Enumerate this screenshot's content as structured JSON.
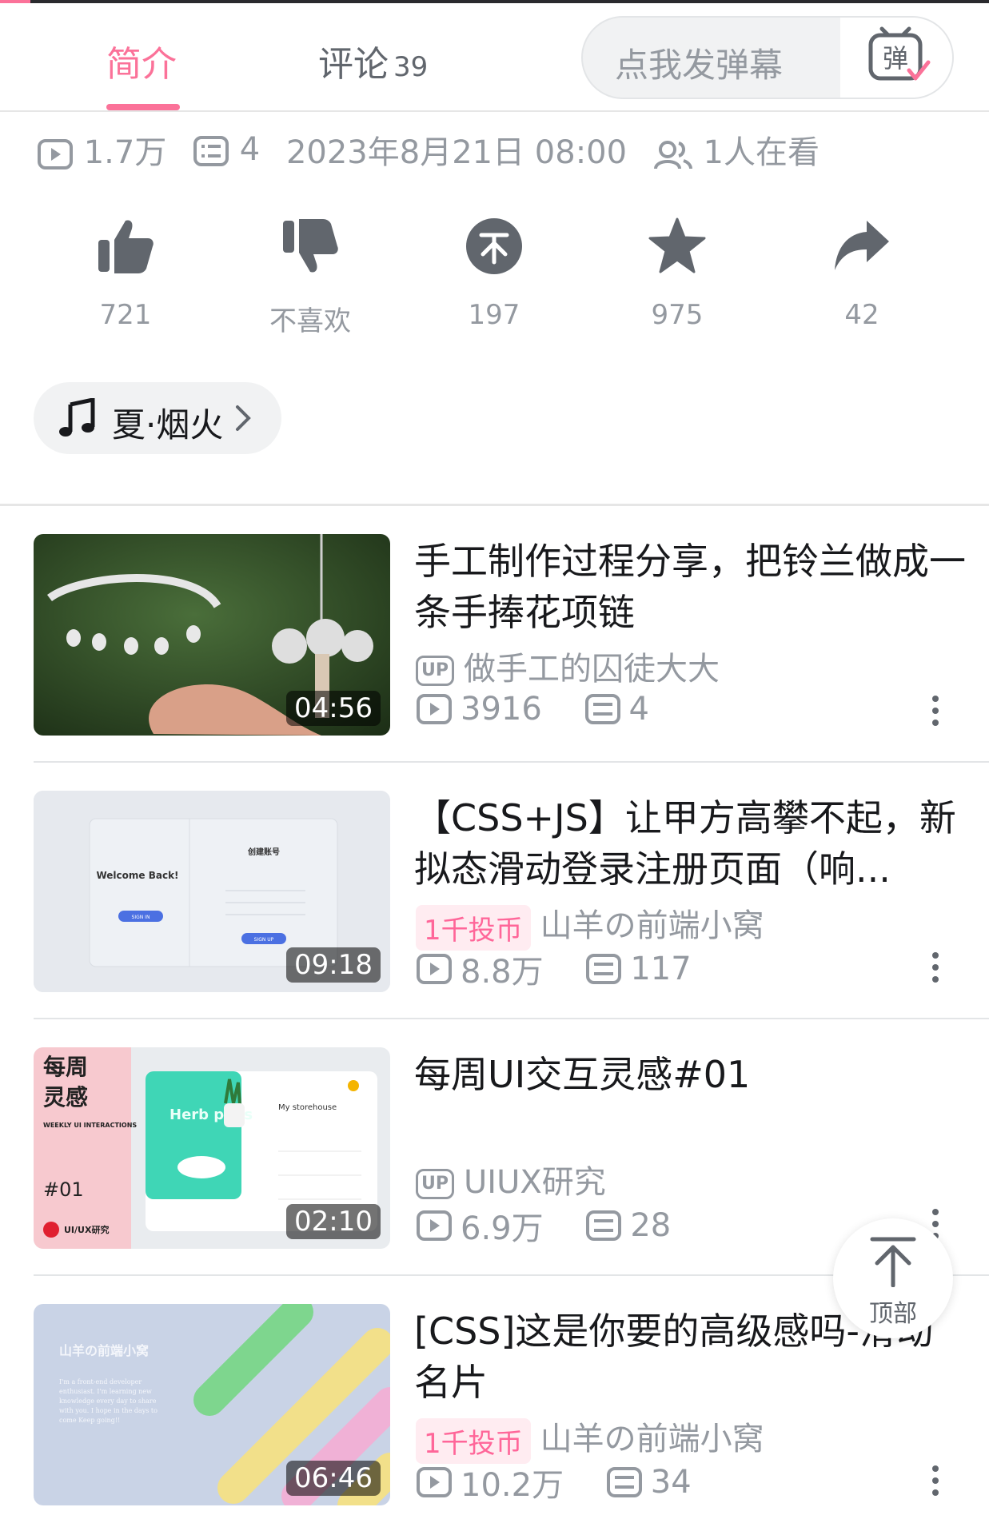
{
  "tabs": [
    {
      "label": "简介",
      "active": true
    },
    {
      "label": "评论",
      "count": "39",
      "active": false
    }
  ],
  "danmaku": {
    "placeholder": "点我发弹幕",
    "button_icon": "danmaku-toggle-icon",
    "button_glyph": "弹"
  },
  "stats": {
    "views": "1.7万",
    "danmaku_count": "4",
    "publish_time": "2023年8月21日 08:00",
    "watching": "1人在看"
  },
  "actions": [
    {
      "icon": "thumb-up-icon",
      "label": "721"
    },
    {
      "icon": "thumb-down-icon",
      "label": "不喜欢"
    },
    {
      "icon": "coin-icon",
      "label": "197"
    },
    {
      "icon": "star-icon",
      "label": "975"
    },
    {
      "icon": "share-icon",
      "label": "42"
    }
  ],
  "music": {
    "title": "夏·烟火"
  },
  "videos": [
    {
      "title": "手工制作过程分享，把铃兰做成一条手捧花项链",
      "up_name": "做手工的囚徒大大",
      "badge": "",
      "views": "3916",
      "danmaku": "4",
      "duration": "04:56"
    },
    {
      "title": "【CSS+JS】让甲方高攀不起，新拟态滑动登录注册页面（响...",
      "up_name": "山羊の前端小窝",
      "badge": "1千投币",
      "views": "8.8万",
      "danmaku": "117",
      "duration": "09:18",
      "thumb": {
        "welcome": "Welcome Back!",
        "signup_title": "创建账号",
        "btn_in": "SIGN IN",
        "btn_up": "SIGN UP"
      }
    },
    {
      "title": "每周UI交互灵感#01",
      "up_name": "UIUX研究",
      "badge": "",
      "views": "6.9万",
      "danmaku": "28",
      "duration": "02:10",
      "thumb": {
        "cn_line1": "每周",
        "cn_line2": "灵感",
        "en": "WEEKLY UI INTERACTIONS",
        "num": "#01",
        "brand": "UI/UX研究",
        "hero": "Herb pods",
        "store": "My storehouse"
      }
    },
    {
      "title": "[CSS]这是你要的高级感吗-滑动名片",
      "up_name": "山羊の前端小窝",
      "badge": "1千投币",
      "views": "10.2万",
      "danmaku": "34",
      "duration": "06:46",
      "thumb": {
        "name": "山羊の前端小窝",
        "bio": "I'm a front-end developer enthusiast. I'm learning new knowledge every day to share with you. I hope in the days to come Keep going!!"
      }
    }
  ],
  "back_to_top": {
    "label": "顶部"
  },
  "colors": {
    "accent": "#fb7299",
    "muted": "#9499a0",
    "text": "#18191c"
  }
}
